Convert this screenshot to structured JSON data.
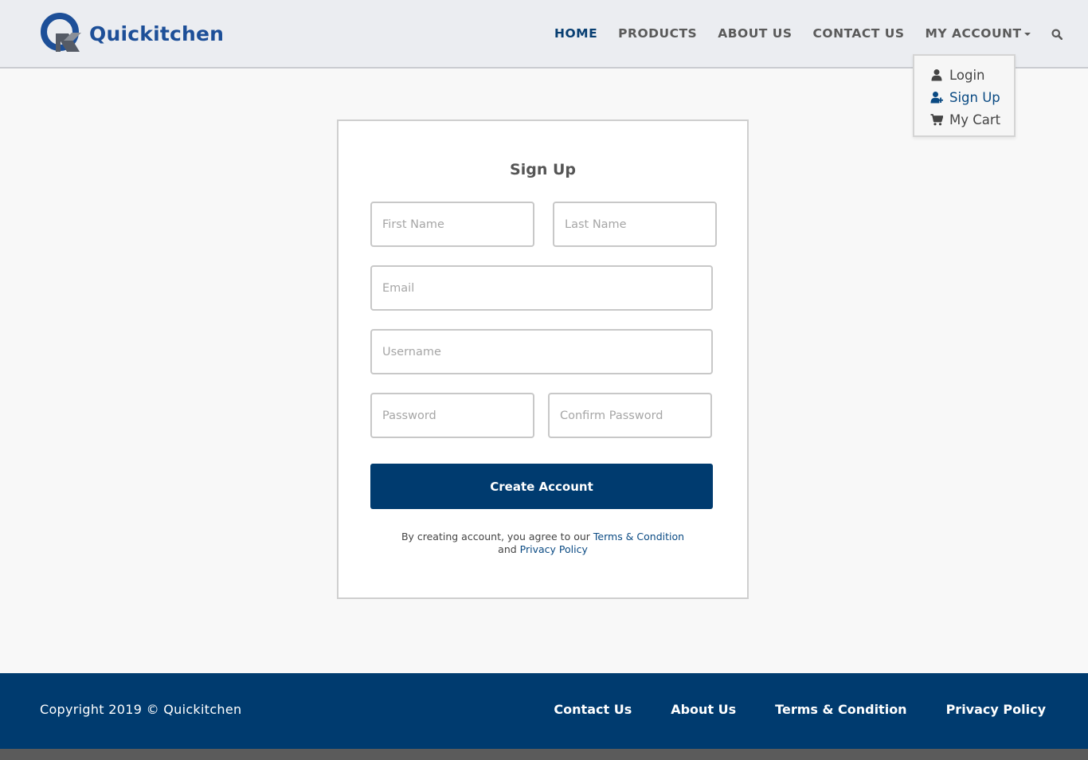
{
  "brand": {
    "name": "Quickitchen",
    "color": "#1d4f98"
  },
  "nav": {
    "items": [
      {
        "label": "HOME",
        "active": true
      },
      {
        "label": "PRODUCTS"
      },
      {
        "label": "ABOUT US"
      },
      {
        "label": "CONTACT US"
      }
    ],
    "account_label": "MY ACCOUNT",
    "search_icon": "search-icon"
  },
  "account_menu": {
    "items": [
      {
        "label": "Login",
        "icon": "user-icon"
      },
      {
        "label": "Sign Up",
        "icon": "user-plus-icon",
        "active": true
      },
      {
        "label": "My Cart",
        "icon": "cart-icon"
      }
    ]
  },
  "signup": {
    "title": "Sign Up",
    "first_name_placeholder": "First Name",
    "last_name_placeholder": "Last Name",
    "email_placeholder": "Email",
    "username_placeholder": "Username",
    "password_placeholder": "Password",
    "confirm_password_placeholder": "Confirm Password",
    "submit_label": "Create Account",
    "terms_prefix": "By creating account, you agree to our ",
    "terms_link": "Terms & Condition",
    "terms_and": "and ",
    "privacy_link": "Privacy Policy"
  },
  "footer": {
    "copyright": "Copyright 2019 © Quickitchen",
    "links": [
      "Contact Us",
      "About Us",
      "Terms & Condition",
      "Privacy Policy"
    ]
  },
  "colors": {
    "primary": "#003b6f",
    "link": "#0a4a83",
    "header_bg": "#ebedf1"
  }
}
